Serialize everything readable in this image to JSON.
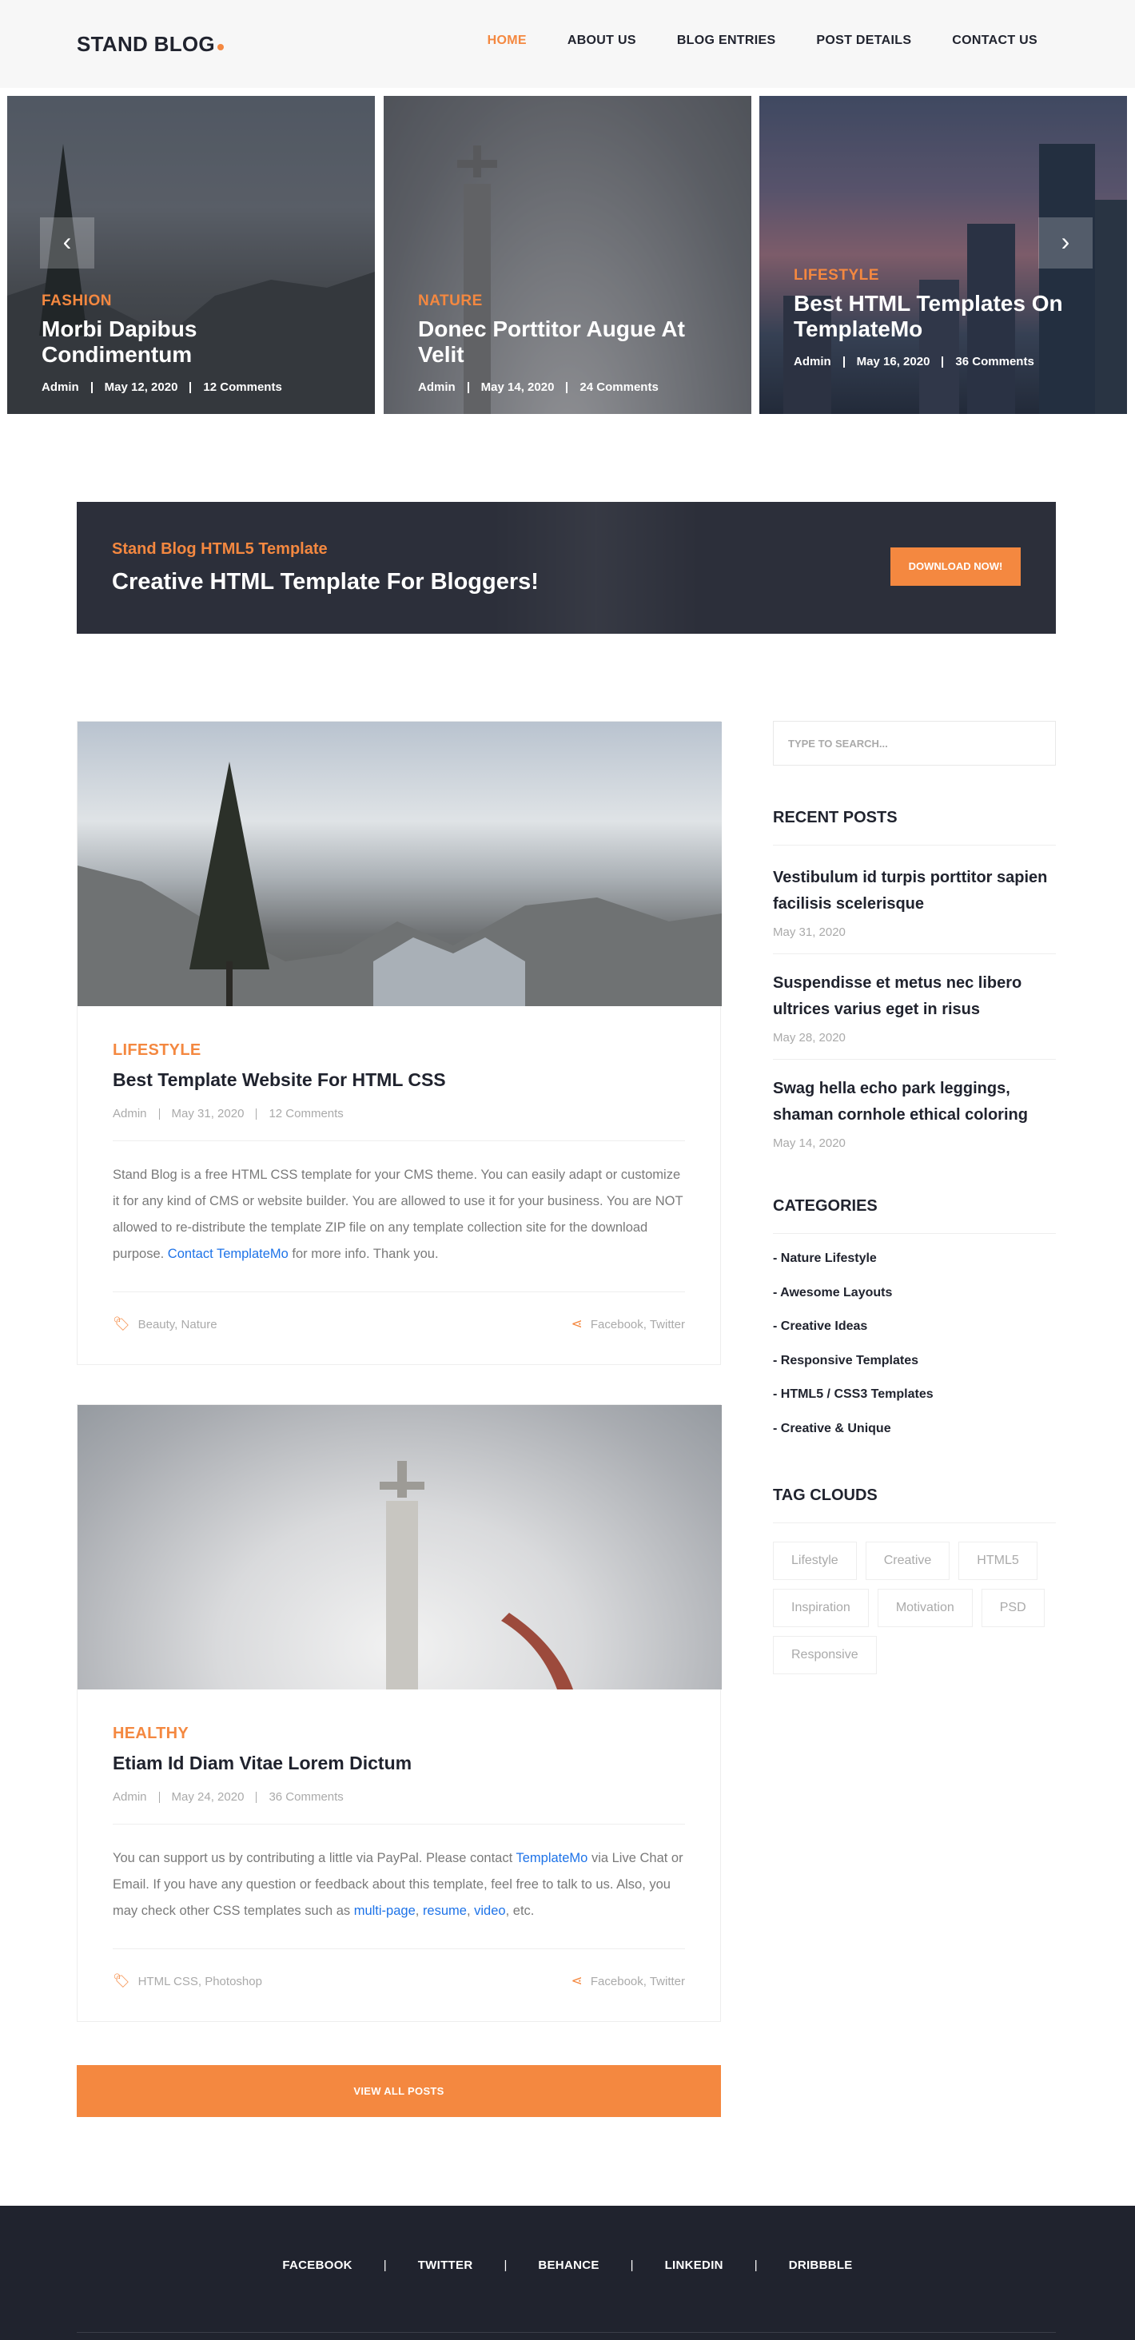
{
  "header": {
    "logo": "STAND BLOG",
    "nav": [
      "HOME",
      "ABOUT US",
      "BLOG ENTRIES",
      "POST DETAILS",
      "CONTACT US"
    ]
  },
  "slider": {
    "prev_arrow": "‹",
    "next_arrow": "›",
    "slides": [
      {
        "category": "FASHION",
        "title": "Morbi Dapibus Condimentum",
        "author": "Admin",
        "date": "May 12, 2020",
        "comments": "12 Comments"
      },
      {
        "category": "NATURE",
        "title": "Donec Porttitor Augue At Velit",
        "author": "Admin",
        "date": "May 14, 2020",
        "comments": "24 Comments"
      },
      {
        "category": "LIFESTYLE",
        "title": "Best HTML Templates On TemplateMo",
        "author": "Admin",
        "date": "May 16, 2020",
        "comments": "36 Comments"
      }
    ]
  },
  "cta": {
    "subtitle": "Stand Blog HTML5 Template",
    "title": "Creative HTML Template For Bloggers!",
    "button": "DOWNLOAD NOW!"
  },
  "posts": [
    {
      "category": "LIFESTYLE",
      "title": "Best Template Website For HTML CSS",
      "author": "Admin",
      "date": "May 31, 2020",
      "comments": "12 Comments",
      "text_before": "Stand Blog is a free HTML CSS template for your CMS theme. You can easily adapt or customize it for any kind of CMS or website builder. You are allowed to use it for your business. You are NOT allowed to re-distribute the template ZIP file on any template collection site for the download purpose. ",
      "link": "Contact TemplateMo",
      "text_after": " for more info. Thank you.",
      "tags": "Beauty, Nature",
      "share": "Facebook, Twitter"
    },
    {
      "category": "HEALTHY",
      "title": "Etiam Id Diam Vitae Lorem Dictum",
      "author": "Admin",
      "date": "May 24, 2020",
      "comments": "36 Comments",
      "text_1": "You can support us by contributing a little via PayPal. Please contact ",
      "link_1": "TemplateMo",
      "text_2": " via Live Chat or Email. If you have any question or feedback about this template, feel free to talk to us. Also, you may check other CSS templates such as ",
      "link_2": "multi-page",
      "sep_1": ", ",
      "link_3": "resume",
      "sep_2": ", ",
      "link_4": "video",
      "text_3": ", etc.",
      "tags": "HTML CSS, Photoshop",
      "share": "Facebook, Twitter"
    }
  ],
  "view_all": "VIEW ALL POSTS",
  "sidebar": {
    "search_placeholder": "TYPE TO SEARCH...",
    "recent_heading": "RECENT POSTS",
    "recent": [
      {
        "title": "Vestibulum id turpis porttitor sapien facilisis scelerisque",
        "date": "May 31, 2020"
      },
      {
        "title": "Suspendisse et metus nec libero ultrices varius eget in risus",
        "date": "May 28, 2020"
      },
      {
        "title": "Swag hella echo park leggings, shaman cornhole ethical coloring",
        "date": "May 14, 2020"
      }
    ],
    "categories_heading": "CATEGORIES",
    "categories": [
      "- Nature Lifestyle",
      "- Awesome Layouts",
      "- Creative Ideas",
      "- Responsive Templates",
      "- HTML5 / CSS3 Templates",
      "- Creative & Unique"
    ],
    "tags_heading": "TAG CLOUDS",
    "tags": [
      "Lifestyle",
      "Creative",
      "HTML5",
      "Inspiration",
      "Motivation",
      "PSD",
      "Responsive"
    ]
  },
  "footer": {
    "social": [
      "FACEBOOK",
      "TWITTER",
      "BEHANCE",
      "LINKEDIN",
      "DRIBBBLE"
    ],
    "separator": "|"
  },
  "colors": {
    "accent": "#f48840",
    "dark": "#20232e",
    "link": "#1e73e8",
    "muted": "#aaaaaa"
  }
}
